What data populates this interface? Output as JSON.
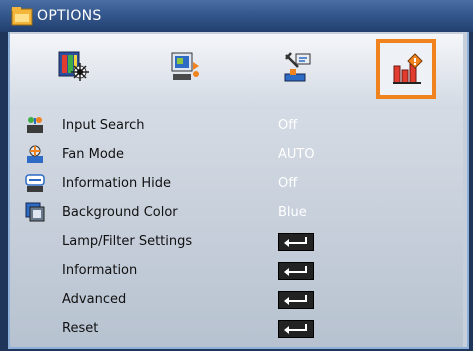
{
  "window": {
    "title": "OPTIONS"
  },
  "tabs": [
    {
      "name": "image-tab",
      "icon": "image-settings-icon",
      "active": false
    },
    {
      "name": "display-tab",
      "icon": "display-settings-icon",
      "active": false
    },
    {
      "name": "setup-tab",
      "icon": "setup-icon",
      "active": false
    },
    {
      "name": "options-tab",
      "icon": "options-icon",
      "active": true
    }
  ],
  "rows": [
    {
      "label": "Input Search",
      "value": "Off",
      "icon": "input-search-icon"
    },
    {
      "label": "Fan Mode",
      "value": "AUTO",
      "icon": "fan-icon"
    },
    {
      "label": "Information Hide",
      "value": "Off",
      "icon": "info-hide-icon"
    },
    {
      "label": "Background Color",
      "value": "Blue",
      "icon": "background-color-icon"
    },
    {
      "label": "Lamp/Filter Settings",
      "value": "",
      "icon": "enter-icon"
    },
    {
      "label": "Information",
      "value": "",
      "icon": "enter-icon"
    },
    {
      "label": "Advanced",
      "value": "",
      "icon": "enter-icon"
    },
    {
      "label": "Reset",
      "value": "",
      "icon": "enter-icon"
    }
  ],
  "colors": {
    "accent": "#f0831e",
    "titlebar": "#34588e",
    "value_text": "#ffffff"
  }
}
